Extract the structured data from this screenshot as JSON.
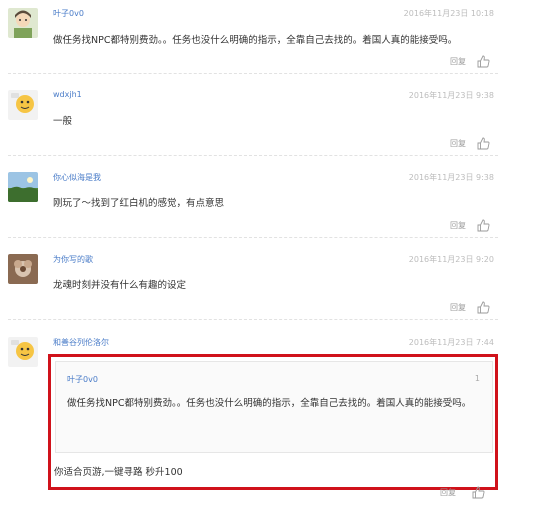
{
  "comments": [
    {
      "username": "叶子0v0",
      "timestamp": "2016年11月23日 10:18",
      "content": "做任务找NPC都特别费劲。。任务也没什么明确的指示，全靠自己去找的。着国人真的能接受吗。",
      "reply_label": "回复",
      "avatar_icon": "avatar-cartoon-icon"
    },
    {
      "username": "wdxjh1",
      "timestamp": "2016年11月23日 9:38",
      "content": "一般",
      "reply_label": "回复",
      "avatar_icon": "avatar-default-icon"
    },
    {
      "username": "你心似海是我",
      "timestamp": "2016年11月23日 9:38",
      "content": "刚玩了～找到了红白机的感觉，有点意思",
      "reply_label": "回复",
      "avatar_icon": "avatar-landscape-icon"
    },
    {
      "username": "为你写的歌",
      "timestamp": "2016年11月23日 9:20",
      "content": "龙魂时刻并没有什么有趣的设定",
      "reply_label": "回复",
      "avatar_icon": "avatar-flower-icon"
    },
    {
      "username": "和善谷列伦洛尔",
      "timestamp": "2016年11月23日 7:44",
      "reply_label": "回复",
      "avatar_icon": "avatar-default-icon",
      "quote": {
        "username": "叶子0v0",
        "floor": "1",
        "content": "做任务找NPC都特别费劲。。任务也没什么明确的指示，全靠自己去找的。着国人真的能接受吗。"
      },
      "content": "你适合页游,一键寻路 秒升100"
    }
  ],
  "colors": {
    "username": "#4a7cc8",
    "timestamp": "#bdbdbd",
    "highlight_border": "#d0121b"
  }
}
